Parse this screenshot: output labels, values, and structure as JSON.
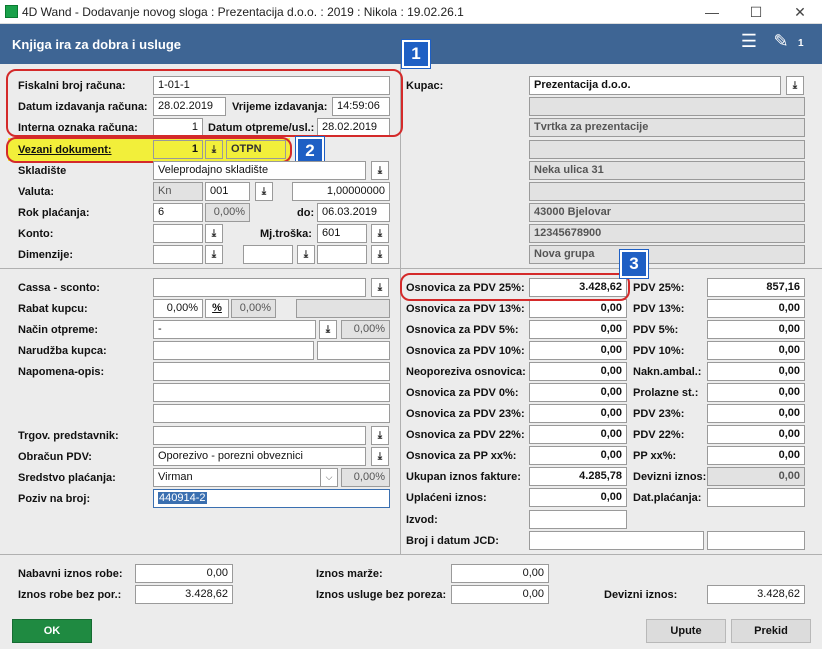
{
  "window": {
    "title": "4D Wand - Dodavanje novog sloga : Prezentacija d.o.o. : 2019 : Nikola : 19.02.26.1",
    "min": "—",
    "max": "☐",
    "close": "✕"
  },
  "header": {
    "title": "Knjiga ira za dobra i usluge",
    "count": "1"
  },
  "top": {
    "fiskalni_label": "Fiskalni broj računa:",
    "fiskalni_value": "1-01-1",
    "datum_izd_label": "Datum izdavanja računa:",
    "datum_izd_value": "28.02.2019",
    "vrijeme_label": "Vrijeme izdavanja:",
    "vrijeme_value": "14:59:06",
    "interna_label": "Interna oznaka računa:",
    "interna_value": "1",
    "datum_otp_label": "Datum otpreme/usl.:",
    "datum_otp_value": "28.02.2019",
    "vezani_label": "Vezani dokument:",
    "vezani_value": "1",
    "vezani_type": "OTPN",
    "skladiste_label": "Skladište",
    "skladiste_value": "Veleprodajno skladište",
    "valuta_label": "Valuta:",
    "valuta_code": "Kn",
    "valuta_num": "001",
    "valuta_rate": "1,00000000",
    "rok_label": "Rok plaćanja:",
    "rok_days": "6",
    "rok_pct": "0,00%",
    "do_label": "do:",
    "rok_date": "06.03.2019",
    "konto_label": "Konto:",
    "mjtroska_label": "Mj.troška:",
    "mjtroska_value": "601",
    "dimenzije_label": "Dimenzije:"
  },
  "kupac": {
    "label": "Kupac:",
    "name": "Prezentacija d.o.o.",
    "line2": "",
    "line3": "Tvrtka za prezentacije",
    "line4": "",
    "address": "Neka ulica 31",
    "line6": "",
    "city": "43000 Bjelovar",
    "oib": "12345678900",
    "group": "Nova grupa"
  },
  "middle": {
    "cassa_label": "Cassa - sconto:",
    "rabat_label": "Rabat kupcu:",
    "rabat_value": "0,00%",
    "rabat_pct_btn": "%",
    "rabat_value2": "0,00%",
    "nacin_label": "Način otpreme:",
    "nacin_value": "-",
    "nacin_pct": "0,00%",
    "narudzba_label": "Narudžba kupca:",
    "napomena_label": "Napomena-opis:",
    "trgov_label": "Trgov. predstavnik:",
    "obracun_label": "Obračun PDV:",
    "obracun_value": "Oporezivo - porezni obveznici",
    "sredstvo_label": "Sredstvo plaćanja:",
    "sredstvo_value": "Virman",
    "sredstvo_pct": "0,00%",
    "poziv_label": "Poziv na broj:",
    "poziv_value": "440914-2"
  },
  "tax": {
    "rows": [
      {
        "label": "Osnovica za PDV 25%:",
        "value": "3.428,62",
        "rlabel": "PDV 25%:",
        "rvalue": "857,16"
      },
      {
        "label": "Osnovica za PDV 13%:",
        "value": "0,00",
        "rlabel": "PDV 13%:",
        "rvalue": "0,00"
      },
      {
        "label": "Osnovica za PDV 5%:",
        "value": "0,00",
        "rlabel": "PDV 5%:",
        "rvalue": "0,00"
      },
      {
        "label": "Osnovica za PDV 10%:",
        "value": "0,00",
        "rlabel": "PDV 10%:",
        "rvalue": "0,00"
      },
      {
        "label": "Neoporeziva osnovica:",
        "value": "0,00",
        "rlabel": "Nakn.ambal.:",
        "rvalue": "0,00"
      },
      {
        "label": "Osnovica za PDV 0%:",
        "value": "0,00",
        "rlabel": "Prolazne st.:",
        "rvalue": "0,00"
      },
      {
        "label": "Osnovica za PDV 23%:",
        "value": "0,00",
        "rlabel": "PDV 23%:",
        "rvalue": "0,00"
      },
      {
        "label": "Osnovica za PDV 22%:",
        "value": "0,00",
        "rlabel": "PDV 22%:",
        "rvalue": "0,00"
      },
      {
        "label": "Osnovica za PP xx%:",
        "value": "0,00",
        "rlabel": "PP xx%:",
        "rvalue": "0,00"
      },
      {
        "label": "Ukupan iznos fakture:",
        "value": "4.285,78",
        "rlabel": "Devizni iznos:",
        "rvalue": "0,00"
      },
      {
        "label": "Uplaćeni iznos:",
        "value": "0,00",
        "rlabel": "Dat.plaćanja:",
        "rvalue": ""
      }
    ],
    "izvod_label": "Izvod:",
    "jcd_label": "Broj i datum JCD:"
  },
  "bottom": {
    "nabavni_label": "Nabavni iznos robe:",
    "nabavni_value": "0,00",
    "bezpor_label": "Iznos robe bez por.:",
    "bezpor_value": "3.428,62",
    "marze_label": "Iznos marže:",
    "marze_value": "0,00",
    "usluge_label": "Iznos usluge bez poreza:",
    "usluge_value": "0,00",
    "devizni_label": "Devizni iznos:",
    "devizni_value": "3.428,62"
  },
  "buttons": {
    "ok": "OK",
    "upute": "Upute",
    "prekid": "Prekid"
  },
  "callouts": {
    "one": "1",
    "two": "2",
    "three": "3"
  },
  "colors": {
    "header": "#3e6594",
    "callout": "#d42a2a",
    "badge": "#1e5fc4",
    "highlight": "#f2ef3a",
    "ok": "#1f8a41"
  }
}
